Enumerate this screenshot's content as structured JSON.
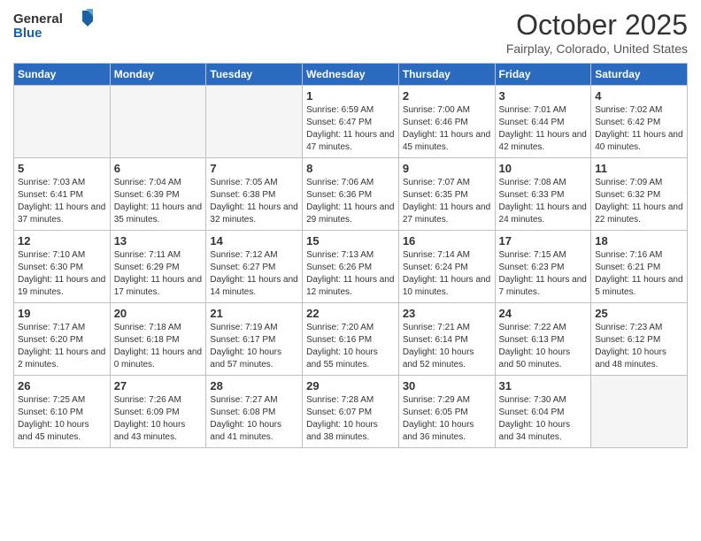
{
  "header": {
    "logo_general": "General",
    "logo_blue": "Blue",
    "title": "October 2025",
    "location": "Fairplay, Colorado, United States"
  },
  "days_of_week": [
    "Sunday",
    "Monday",
    "Tuesday",
    "Wednesday",
    "Thursday",
    "Friday",
    "Saturday"
  ],
  "weeks": [
    [
      {
        "day": "",
        "empty": true
      },
      {
        "day": "",
        "empty": true
      },
      {
        "day": "",
        "empty": true
      },
      {
        "day": "1",
        "sunrise": "6:59 AM",
        "sunset": "6:47 PM",
        "daylight": "11 hours and 47 minutes."
      },
      {
        "day": "2",
        "sunrise": "7:00 AM",
        "sunset": "6:46 PM",
        "daylight": "11 hours and 45 minutes."
      },
      {
        "day": "3",
        "sunrise": "7:01 AM",
        "sunset": "6:44 PM",
        "daylight": "11 hours and 42 minutes."
      },
      {
        "day": "4",
        "sunrise": "7:02 AM",
        "sunset": "6:42 PM",
        "daylight": "11 hours and 40 minutes."
      }
    ],
    [
      {
        "day": "5",
        "sunrise": "7:03 AM",
        "sunset": "6:41 PM",
        "daylight": "11 hours and 37 minutes."
      },
      {
        "day": "6",
        "sunrise": "7:04 AM",
        "sunset": "6:39 PM",
        "daylight": "11 hours and 35 minutes."
      },
      {
        "day": "7",
        "sunrise": "7:05 AM",
        "sunset": "6:38 PM",
        "daylight": "11 hours and 32 minutes."
      },
      {
        "day": "8",
        "sunrise": "7:06 AM",
        "sunset": "6:36 PM",
        "daylight": "11 hours and 29 minutes."
      },
      {
        "day": "9",
        "sunrise": "7:07 AM",
        "sunset": "6:35 PM",
        "daylight": "11 hours and 27 minutes."
      },
      {
        "day": "10",
        "sunrise": "7:08 AM",
        "sunset": "6:33 PM",
        "daylight": "11 hours and 24 minutes."
      },
      {
        "day": "11",
        "sunrise": "7:09 AM",
        "sunset": "6:32 PM",
        "daylight": "11 hours and 22 minutes."
      }
    ],
    [
      {
        "day": "12",
        "sunrise": "7:10 AM",
        "sunset": "6:30 PM",
        "daylight": "11 hours and 19 minutes."
      },
      {
        "day": "13",
        "sunrise": "7:11 AM",
        "sunset": "6:29 PM",
        "daylight": "11 hours and 17 minutes."
      },
      {
        "day": "14",
        "sunrise": "7:12 AM",
        "sunset": "6:27 PM",
        "daylight": "11 hours and 14 minutes."
      },
      {
        "day": "15",
        "sunrise": "7:13 AM",
        "sunset": "6:26 PM",
        "daylight": "11 hours and 12 minutes."
      },
      {
        "day": "16",
        "sunrise": "7:14 AM",
        "sunset": "6:24 PM",
        "daylight": "11 hours and 10 minutes."
      },
      {
        "day": "17",
        "sunrise": "7:15 AM",
        "sunset": "6:23 PM",
        "daylight": "11 hours and 7 minutes."
      },
      {
        "day": "18",
        "sunrise": "7:16 AM",
        "sunset": "6:21 PM",
        "daylight": "11 hours and 5 minutes."
      }
    ],
    [
      {
        "day": "19",
        "sunrise": "7:17 AM",
        "sunset": "6:20 PM",
        "daylight": "11 hours and 2 minutes."
      },
      {
        "day": "20",
        "sunrise": "7:18 AM",
        "sunset": "6:18 PM",
        "daylight": "11 hours and 0 minutes."
      },
      {
        "day": "21",
        "sunrise": "7:19 AM",
        "sunset": "6:17 PM",
        "daylight": "10 hours and 57 minutes."
      },
      {
        "day": "22",
        "sunrise": "7:20 AM",
        "sunset": "6:16 PM",
        "daylight": "10 hours and 55 minutes."
      },
      {
        "day": "23",
        "sunrise": "7:21 AM",
        "sunset": "6:14 PM",
        "daylight": "10 hours and 52 minutes."
      },
      {
        "day": "24",
        "sunrise": "7:22 AM",
        "sunset": "6:13 PM",
        "daylight": "10 hours and 50 minutes."
      },
      {
        "day": "25",
        "sunrise": "7:23 AM",
        "sunset": "6:12 PM",
        "daylight": "10 hours and 48 minutes."
      }
    ],
    [
      {
        "day": "26",
        "sunrise": "7:25 AM",
        "sunset": "6:10 PM",
        "daylight": "10 hours and 45 minutes."
      },
      {
        "day": "27",
        "sunrise": "7:26 AM",
        "sunset": "6:09 PM",
        "daylight": "10 hours and 43 minutes."
      },
      {
        "day": "28",
        "sunrise": "7:27 AM",
        "sunset": "6:08 PM",
        "daylight": "10 hours and 41 minutes."
      },
      {
        "day": "29",
        "sunrise": "7:28 AM",
        "sunset": "6:07 PM",
        "daylight": "10 hours and 38 minutes."
      },
      {
        "day": "30",
        "sunrise": "7:29 AM",
        "sunset": "6:05 PM",
        "daylight": "10 hours and 36 minutes."
      },
      {
        "day": "31",
        "sunrise": "7:30 AM",
        "sunset": "6:04 PM",
        "daylight": "10 hours and 34 minutes."
      },
      {
        "day": "",
        "empty": true
      }
    ]
  ]
}
